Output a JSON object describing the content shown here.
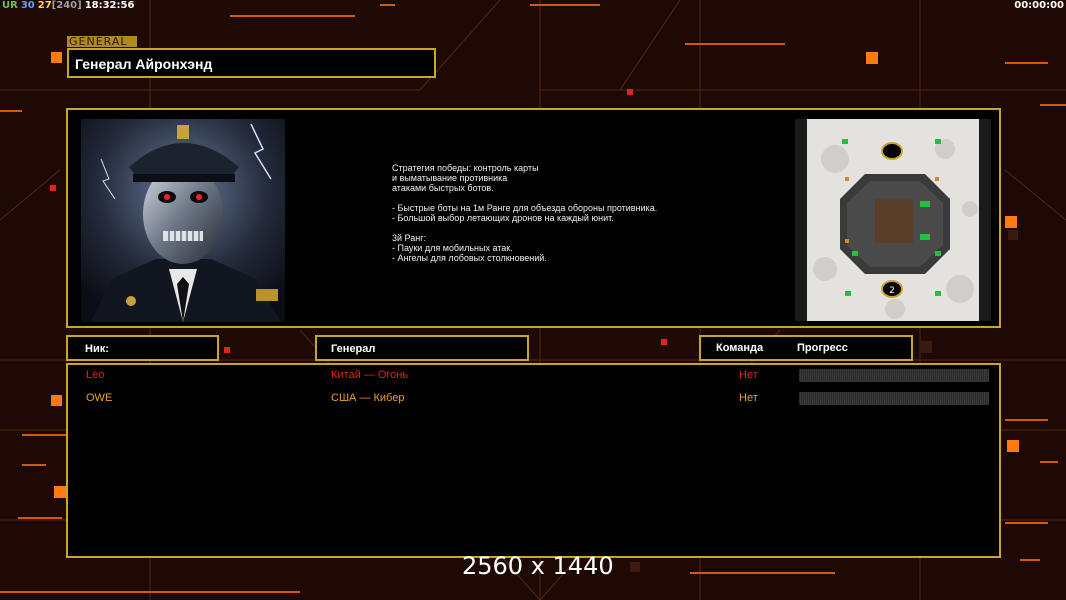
{
  "hud": {
    "ur_label": "UR",
    "ur_value": "30",
    "fps": "27",
    "fps_max": "[240]",
    "clock": "18:32:56",
    "timer": "00:00:00"
  },
  "general_tag": "GENERAL",
  "general_name": "Генерал Айронхэнд",
  "description": "Стратегия победы: контроль карты\nи выматывание противника\nатаками быстрых ботов.\n\n- Быстрые боты на 1м Ранге для объезда обороны противника.\n- Большой выбор летающих дронов на каждый юнит.\n\n3й Ранг:\n- Пауки для мобильных атак.\n- Ангелы для лобовых столкновений.",
  "minimap": {
    "spawn_marker_2": "2",
    "spawn_marker_1": "2"
  },
  "columns": {
    "nick": "Ник:",
    "general": "Генерал",
    "team": "Команда",
    "progress": "Прогресс"
  },
  "players": [
    {
      "nick": "Leo",
      "general": "Китай — Огонь",
      "team": "Нет",
      "progress": 0,
      "color": "#e0241c"
    },
    {
      "nick": "OWE",
      "general": "США — Кибер",
      "team": "Нет",
      "progress": 0,
      "color": "#e8a030"
    }
  ],
  "resolution": "2560 x 1440",
  "colors": {
    "accent": "#c9a62a",
    "background": "#1e0905",
    "orange": "#ff7a10"
  }
}
